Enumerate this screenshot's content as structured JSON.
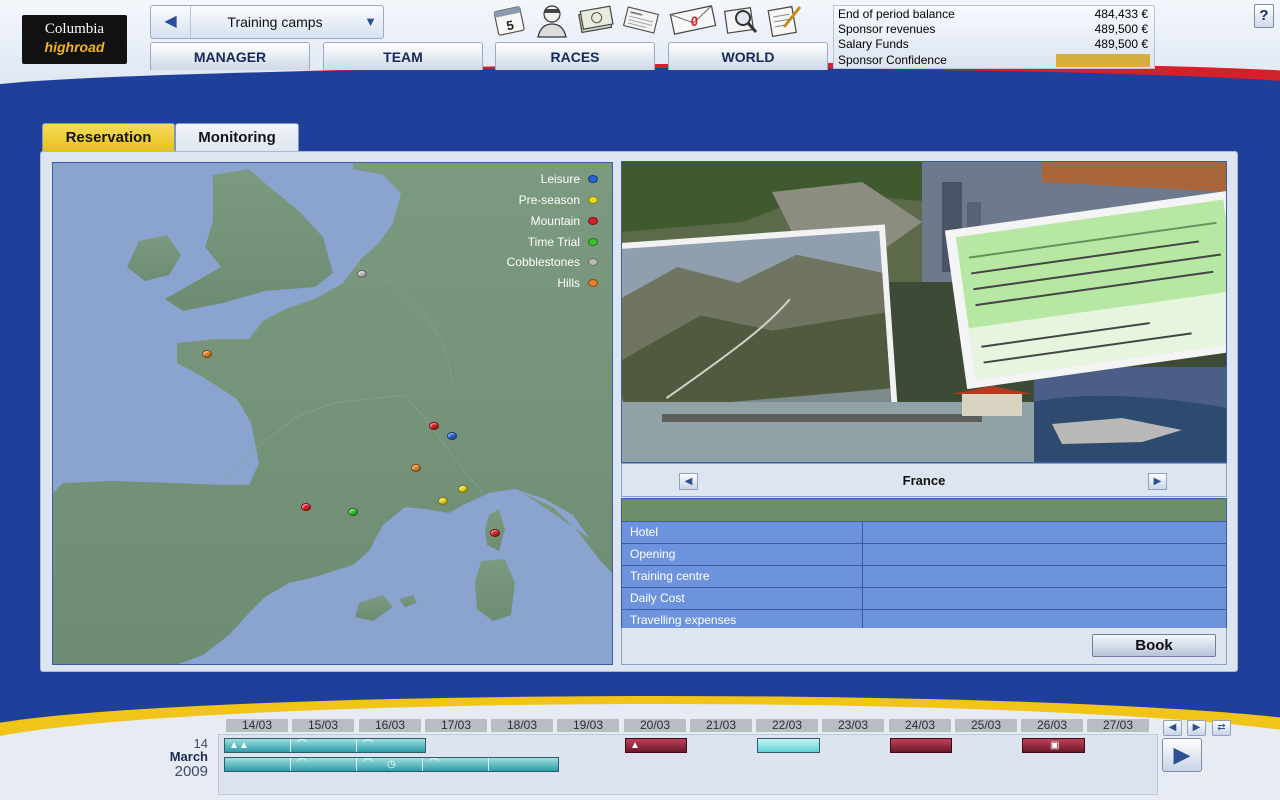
{
  "app": {
    "logo_line1": "Columbia",
    "logo_line2": "highroad"
  },
  "header": {
    "screen_title": "Training camps",
    "nav": [
      "MANAGER",
      "TEAM",
      "RACES",
      "WORLD"
    ],
    "tool_icons": [
      "calendar-icon",
      "rider-helmet-icon",
      "money-icon",
      "newspaper-icon",
      "mail-icon",
      "magnifier-icon",
      "notepad-icon"
    ],
    "calendar_icon_number": "5",
    "mail_count": "0",
    "help_label": "?"
  },
  "finance": {
    "rows": [
      {
        "label": "End of period balance",
        "value": "484,433 €"
      },
      {
        "label": "Sponsor revenues",
        "value": "489,500 €"
      },
      {
        "label": "Salary Funds",
        "value": "489,500 €"
      },
      {
        "label": "Sponsor Confidence",
        "value": ""
      }
    ],
    "confidence_color": "#d6ae3c"
  },
  "tabs": {
    "reservation": "Reservation",
    "monitoring": "Monitoring",
    "active": "Reservation"
  },
  "map": {
    "legend": [
      {
        "label": "Leisure",
        "color": "#2a63d6"
      },
      {
        "label": "Pre-season",
        "color": "#e8d81c"
      },
      {
        "label": "Mountain",
        "color": "#d8202a"
      },
      {
        "label": "Time Trial",
        "color": "#39c233"
      },
      {
        "label": "Cobblestones",
        "color": "#b9b9b9"
      },
      {
        "label": "Hills",
        "color": "#e4812a"
      }
    ]
  },
  "detail": {
    "country": "France",
    "rows": [
      {
        "label": "Hotel",
        "value": ""
      },
      {
        "label": "Opening",
        "value": ""
      },
      {
        "label": "Training centre",
        "value": ""
      },
      {
        "label": "Daily Cost",
        "value": ""
      },
      {
        "label": "Travelling expenses",
        "value": ""
      }
    ],
    "book_label": "Book"
  },
  "calendar": {
    "day": "14",
    "month": "March",
    "year": "2009",
    "days": [
      "14/03",
      "15/03",
      "16/03",
      "17/03",
      "18/03",
      "19/03",
      "20/03",
      "21/03",
      "22/03",
      "23/03",
      "24/03",
      "25/03",
      "26/03",
      "27/03"
    ]
  }
}
